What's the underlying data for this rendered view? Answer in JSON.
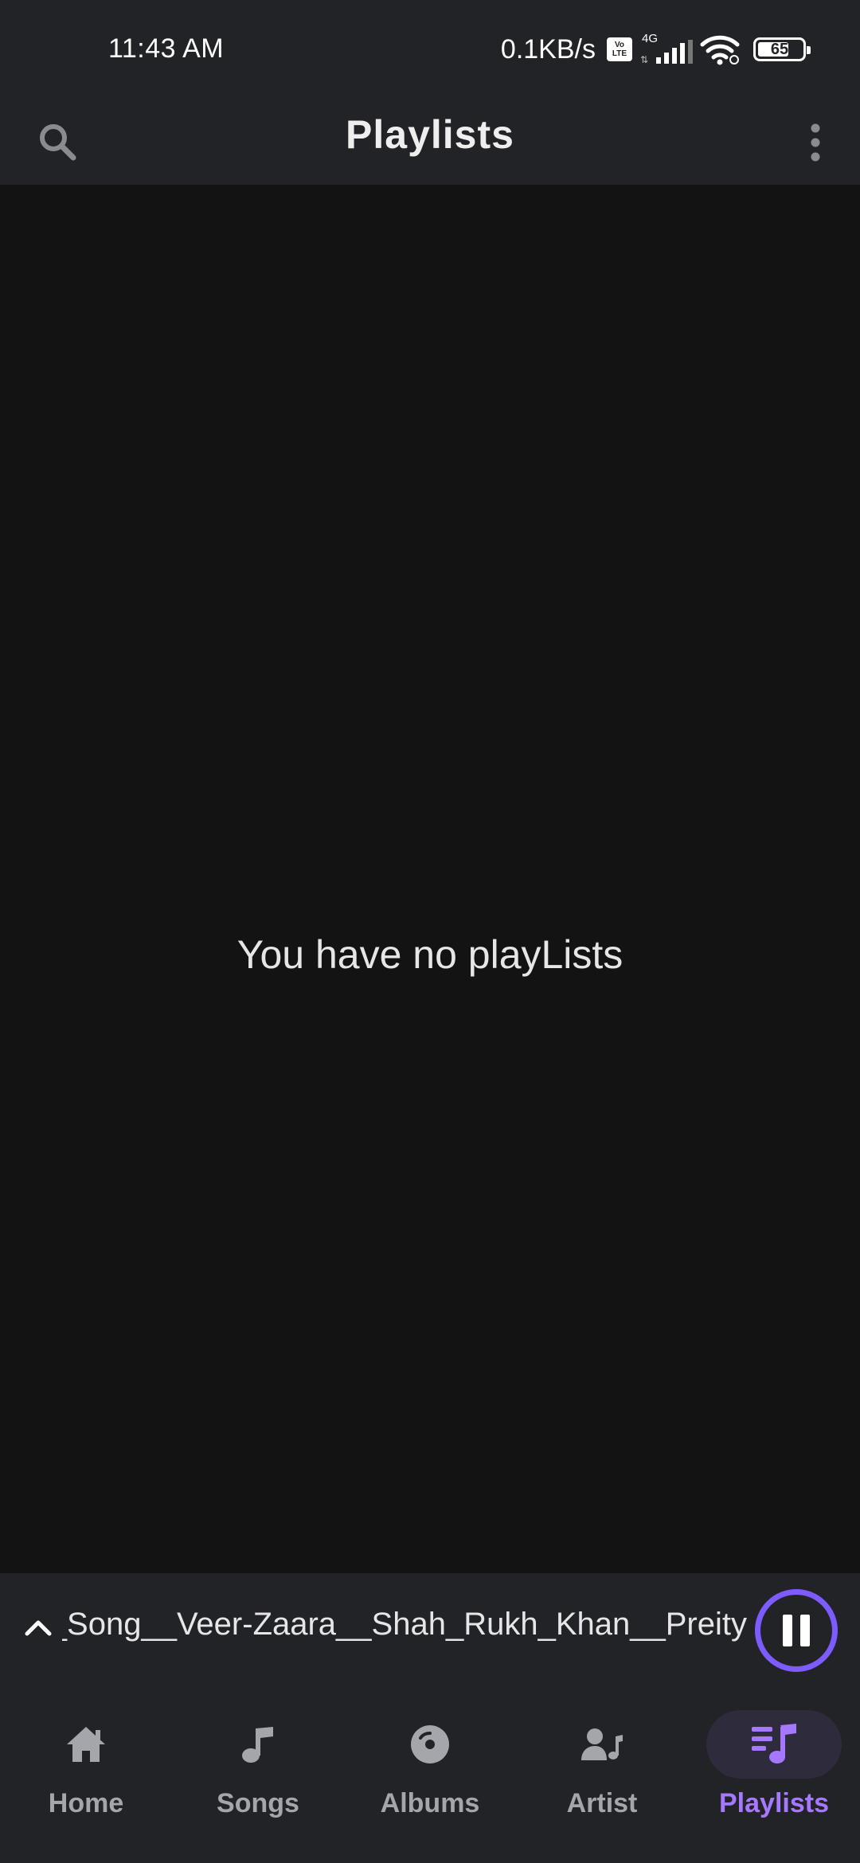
{
  "status_bar": {
    "time": "11:43 AM",
    "net_speed": "0.1KB/s",
    "volte_top": "Vo",
    "volte_bottom": "LTE",
    "network_type": "4G",
    "battery_level": "65"
  },
  "header": {
    "title": "Playlists",
    "search_icon": "search-icon",
    "more_icon": "more-vertical-icon"
  },
  "main": {
    "empty_message": "You have no playLists"
  },
  "mini_player": {
    "track_title": "ull_Song__Veer-Zaara__Shah_Rukh_Khan__Preity",
    "state": "playing",
    "expand_icon": "chevron-up-icon",
    "pause_icon": "pause-icon"
  },
  "bottom_nav": {
    "items": [
      {
        "label": "Home",
        "icon": "home-icon",
        "active": false
      },
      {
        "label": "Songs",
        "icon": "music-note-icon",
        "active": false
      },
      {
        "label": "Albums",
        "icon": "album-disc-icon",
        "active": false
      },
      {
        "label": "Artist",
        "icon": "artist-icon",
        "active": false
      },
      {
        "label": "Playlists",
        "icon": "playlist-icon",
        "active": true
      }
    ]
  },
  "colors": {
    "background": "#131314",
    "bar_background": "#222327",
    "accent": "#a678ff",
    "player_ring": "#7c5cff",
    "inactive": "#a5a6ab"
  }
}
